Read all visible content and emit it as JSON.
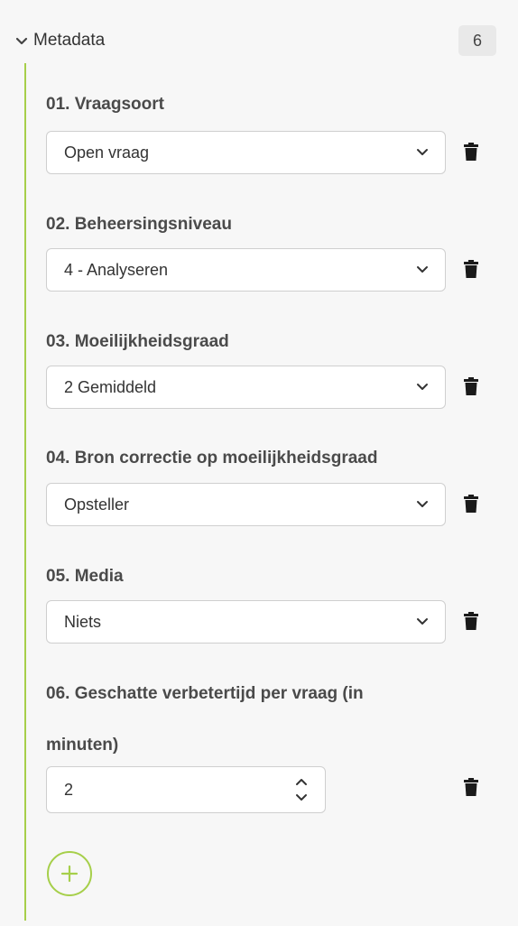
{
  "section": {
    "title": "Metadata",
    "count": "6",
    "toggle_icon": "chevron-down-icon"
  },
  "fields": [
    {
      "label": "01. Vraagsoort",
      "value": "Open vraag"
    },
    {
      "label": "02. Beheersingsniveau",
      "value": "4 - Analyseren"
    },
    {
      "label": "03. Moeilijkheidsgraad",
      "value": "2 Gemiddeld"
    },
    {
      "label": "04. Bron correctie op moeilijkheidsgraad",
      "value": "Opsteller"
    },
    {
      "label": "05. Media",
      "value": "Niets"
    }
  ],
  "time_field": {
    "label_line1": "06. Geschatte verbetertijd per vraag (in",
    "label_line2": "minuten)",
    "value": "2"
  },
  "icons": {
    "delete": "trash-icon",
    "select": "chevron-down-icon",
    "stepper": "spinner-icon",
    "add": "plus-icon"
  },
  "colors": {
    "accent": "#a6cf4a",
    "badge_bg": "#e9e9e9",
    "background": "#f7f7f7"
  }
}
